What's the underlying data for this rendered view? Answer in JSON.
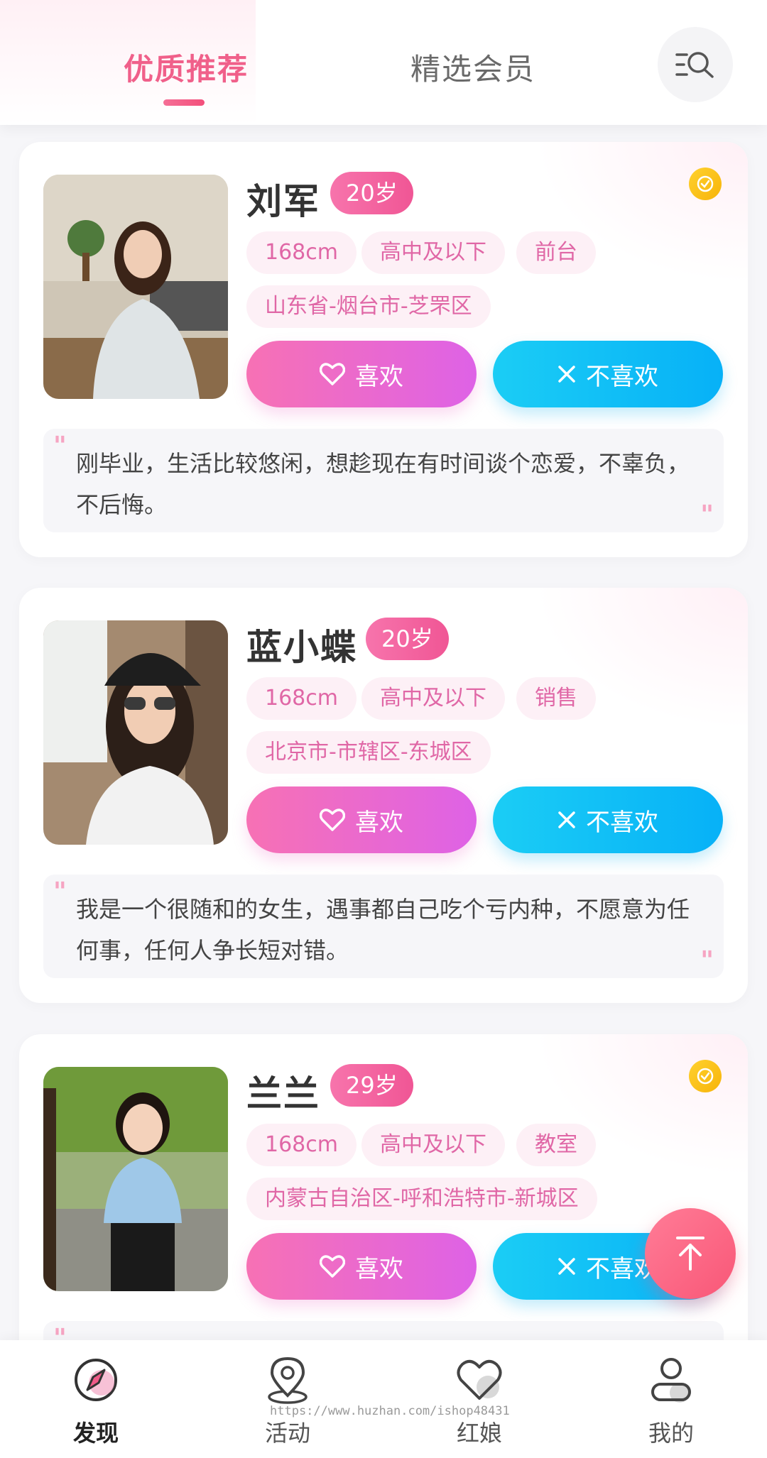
{
  "header": {
    "tabs": [
      {
        "label": "优质推荐",
        "active": true
      },
      {
        "label": "精选会员",
        "active": false
      }
    ],
    "search_icon": "search-filter-icon"
  },
  "colors": {
    "accent": "#f0608a",
    "tag_text": "#e067a6",
    "like_start": "#f771b4",
    "like_end": "#de62e6",
    "dislike_start": "#1bcdf5",
    "dislike_end": "#07b1f7"
  },
  "buttons": {
    "like": "喜欢",
    "dislike": "不喜欢"
  },
  "profiles": [
    {
      "name": "刘军",
      "age": "20岁",
      "height": "168cm",
      "education": "高中及以下",
      "job": "前台",
      "location": "山东省-烟台市-芝罘区",
      "verified": true,
      "intro": "刚毕业，生活比较悠闲，想趁现在有时间谈个恋爱，不辜负，不后悔。"
    },
    {
      "name": "蓝小蝶",
      "age": "20岁",
      "height": "168cm",
      "education": "高中及以下",
      "job": "销售",
      "location": "北京市-市辖区-东城区",
      "verified": false,
      "intro": "我是一个很随和的女生，遇事都自己吃个亏内种，不愿意为任何事，任何人争长短对错。"
    },
    {
      "name": "兰兰",
      "age": "29岁",
      "height": "168cm",
      "education": "高中及以下",
      "job": "教室",
      "location": "内蒙古自治区-呼和浩特市-新城区",
      "verified": true,
      "intro": ""
    }
  ],
  "nav": [
    {
      "label": "发现",
      "icon": "compass-icon",
      "active": true
    },
    {
      "label": "活动",
      "icon": "location-pin-icon",
      "active": false
    },
    {
      "label": "红娘",
      "icon": "heart-icon",
      "active": false
    },
    {
      "label": "我的",
      "icon": "user-icon",
      "active": false
    }
  ],
  "watermark": "https://www.huzhan.com/ishop48431"
}
